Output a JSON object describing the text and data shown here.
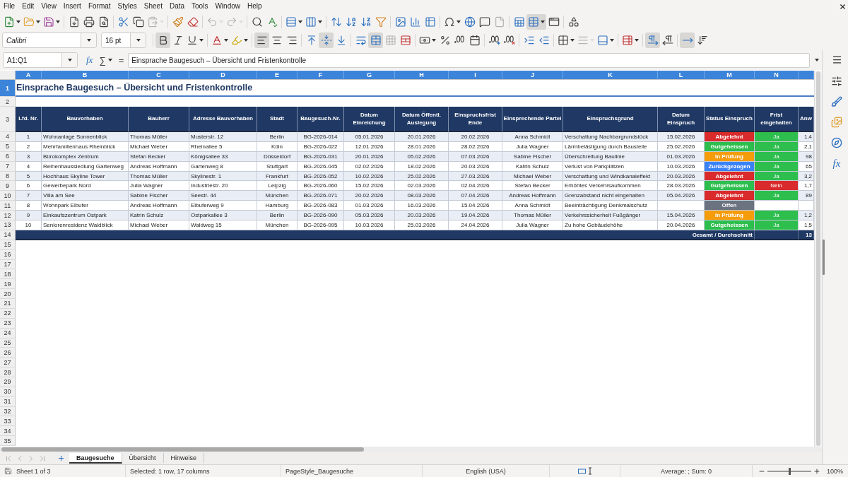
{
  "menu_bar": [
    "File",
    "Edit",
    "View",
    "Insert",
    "Format",
    "Styles",
    "Sheet",
    "Data",
    "Tools",
    "Window",
    "Help"
  ],
  "standard_toolbar": {
    "paste_enabled": false,
    "undo_enabled": false,
    "redo_enabled": false,
    "header_footer_enabled": false,
    "freeze_rows_columns": true
  },
  "formatting_toolbar": {
    "font_name": "Calibri",
    "font_size": "16 pt",
    "bold": true,
    "italic": false,
    "underline": false,
    "align_left": true,
    "align_center": false,
    "align_right": false,
    "align_top": false,
    "center_vertically": true,
    "align_bottom": false,
    "merge_and_center": true,
    "merge_cells_enabled": false,
    "border_style_enabled": false,
    "left_to_right": true,
    "right_to_left": false,
    "text_horizontal": true,
    "text_vertical": false
  },
  "formula_bar": {
    "name_box": "A1:Q1",
    "function_wizard": "fx",
    "sum": "∑",
    "formula": "=",
    "content": "Einsprache Baugesuch – Übersicht und Fristenkontrolle"
  },
  "sheet": {
    "columns": [
      {
        "label": "A",
        "selected": true
      },
      {
        "label": "B",
        "selected": true
      },
      {
        "label": "C",
        "selected": true
      },
      {
        "label": "D",
        "selected": true
      },
      {
        "label": "E",
        "selected": true
      },
      {
        "label": "F",
        "selected": true
      },
      {
        "label": "G",
        "selected": true
      },
      {
        "label": "H",
        "selected": true
      },
      {
        "label": "I",
        "selected": true
      },
      {
        "label": "J",
        "selected": true
      },
      {
        "label": "K",
        "selected": true
      },
      {
        "label": "L",
        "selected": true
      },
      {
        "label": "M",
        "selected": true
      },
      {
        "label": "N",
        "selected": true
      },
      {
        "selected": true
      }
    ],
    "rows": [
      {
        "label": "1",
        "selected": true
      },
      {
        "label": "2",
        "selected": false
      },
      {
        "label": "3",
        "selected": false
      },
      {
        "label": "4",
        "selected": false
      },
      {
        "label": "5",
        "selected": false
      },
      {
        "label": "6",
        "selected": false
      },
      {
        "label": "7",
        "selected": false
      },
      {
        "label": "8",
        "selected": false
      },
      {
        "label": "9",
        "selected": false
      },
      {
        "label": "10",
        "selected": false
      },
      {
        "label": "11",
        "selected": false
      },
      {
        "label": "12",
        "selected": false
      },
      {
        "label": "13",
        "selected": false
      },
      {
        "label": "14",
        "selected": false
      },
      {
        "label": "15",
        "selected": false
      },
      {
        "label": "16",
        "selected": false
      },
      {
        "label": "17",
        "selected": false
      },
      {
        "label": "18",
        "selected": false
      },
      {
        "label": "19",
        "selected": false
      },
      {
        "label": "20",
        "selected": false
      },
      {
        "label": "21",
        "selected": false
      },
      {
        "label": "22",
        "selected": false
      },
      {
        "label": "23",
        "selected": false
      },
      {
        "label": "24",
        "selected": false
      },
      {
        "label": "25",
        "selected": false
      },
      {
        "label": "26",
        "selected": false
      },
      {
        "label": "27",
        "selected": false
      },
      {
        "label": "28",
        "selected": false
      },
      {
        "label": "29",
        "selected": false
      },
      {
        "label": "30",
        "selected": false
      },
      {
        "label": "31",
        "selected": false
      },
      {
        "label": "32",
        "selected": false
      },
      {
        "label": "33",
        "selected": false
      },
      {
        "label": "34",
        "selected": false
      },
      {
        "label": "35",
        "selected": false
      }
    ]
  },
  "title": "Einsprache Baugesuch – Übersicht und Fristenkontrolle",
  "table": {
    "header": [
      "Lfd. Nr.",
      "Bauvorhaben",
      "Bauherr",
      "Adresse Bauvorhaben",
      "Stadt",
      "Baugesuch-Nr.",
      "Datum Einreichung",
      "Datum Öffentl. Auslegung",
      "Einspruchsfrist Ende",
      "Einsprechende Partei",
      "Einspruchsgrund",
      "Datum Einspruch",
      "Status Einspruch",
      "Frist eingehalten",
      "Anw"
    ],
    "records": [
      {
        "nr": "1",
        "project": "Wohnanlage Sonnenblick",
        "owner": "Thomas Müller",
        "address": "Musterstr. 12",
        "city": "Berlin",
        "application_no": "BG-2026-014",
        "submitted": "05.01.2026",
        "published": "20.01.2026",
        "objection_deadline": "20.02.2026",
        "objector": "Anna Schmidt",
        "reason": "Verschattung Nachbargrundstück",
        "objection_date": "15.02.2026",
        "status": {
          "text": "Abgelehnt",
          "color": "#d92b2b"
        },
        "deadline_met": {
          "text": "Ja",
          "color": "#2dbe4e"
        },
        "column_15": "1,4"
      },
      {
        "nr": "2",
        "project": "Mehrfamilienhaus Rheinblick",
        "owner": "Michael Weber",
        "address": "Rheinallee 5",
        "city": "Köln",
        "application_no": "BG-2026-022",
        "submitted": "12.01.2026",
        "published": "28.01.2026",
        "objection_deadline": "28.02.2026",
        "objector": "Julia Wagner",
        "reason": "Lärmbelästigung durch Baustelle",
        "objection_date": "25.02.2026",
        "status": {
          "text": "Gutgeheissen",
          "color": "#2dbe4e"
        },
        "deadline_met": {
          "text": "Ja",
          "color": "#2dbe4e"
        },
        "column_15": "2,1"
      },
      {
        "nr": "3",
        "project": "Bürokomplex Zentrum",
        "owner": "Stefan Becker",
        "address": "Königsallee 33",
        "city": "Düsseldorf",
        "application_no": "BG-2026-031",
        "submitted": "20.01.2026",
        "published": "05.02.2026",
        "objection_deadline": "07.03.2026",
        "objector": "Sabine Fischer",
        "reason": "Überschreitung Baulinie",
        "objection_date": "01.03.2026",
        "status": {
          "text": "In Prüfung",
          "color": "#f59c0b"
        },
        "deadline_met": {
          "text": "Ja",
          "color": "#2dbe4e"
        },
        "column_15": "98"
      },
      {
        "nr": "4",
        "project": "Reihenhaussiedlung Gartenweg",
        "owner": "Andreas Hoffmann",
        "address": "Gartenweg 8",
        "city": "Stuttgart",
        "application_no": "BG-2026-045",
        "submitted": "02.02.2026",
        "published": "18.02.2026",
        "objection_deadline": "20.03.2026",
        "objector": "Katrin Schulz",
        "reason": "Verlust von Parkplätzen",
        "objection_date": "10.03.2026",
        "status": {
          "text": "Zurückgezogen",
          "color": "#3b82f6"
        },
        "deadline_met": {
          "text": "Ja",
          "color": "#2dbe4e"
        },
        "column_15": "65"
      },
      {
        "nr": "5",
        "project": "Hochhaus Skyline Tower",
        "owner": "Thomas Müller",
        "address": "Skylinestr. 1",
        "city": "Frankfurt",
        "application_no": "BG-2026-052",
        "submitted": "10.02.2026",
        "published": "25.02.2026",
        "objection_deadline": "27.03.2026",
        "objector": "Michael Weber",
        "reason": "Verschattung und Windkanaleffekt",
        "objection_date": "20.03.2026",
        "status": {
          "text": "Abgelehnt",
          "color": "#d92b2b"
        },
        "deadline_met": {
          "text": "Ja",
          "color": "#2dbe4e"
        },
        "column_15": "3,2"
      },
      {
        "nr": "6",
        "project": "Gewerbepark Nord",
        "owner": "Julia Wagner",
        "address": "Industriestr. 20",
        "city": "Leipzig",
        "application_no": "BG-2026-060",
        "submitted": "15.02.2026",
        "published": "02.03.2026",
        "objection_deadline": "02.04.2026",
        "objector": "Stefan Becker",
        "reason": "Erhöhtes Verkehrsaufkommen",
        "objection_date": "28.03.2026",
        "status": {
          "text": "Gutgeheissen",
          "color": "#2dbe4e"
        },
        "deadline_met": {
          "text": "Nein",
          "color": "#d92b2b"
        },
        "column_15": "1,7"
      },
      {
        "nr": "7",
        "project": "Villa am See",
        "owner": "Sabine Fischer",
        "address": "Seestr. 44",
        "city": "München",
        "application_no": "BG-2026-071",
        "submitted": "20.02.2026",
        "published": "08.03.2026",
        "objection_deadline": "07.04.2026",
        "objector": "Andreas Hoffmann",
        "reason": "Grenzabstand nicht eingehalten",
        "objection_date": "05.04.2026",
        "status": {
          "text": "Abgelehnt",
          "color": "#d92b2b"
        },
        "deadline_met": {
          "text": "Ja",
          "color": "#2dbe4e"
        },
        "column_15": "89"
      },
      {
        "nr": "8",
        "project": "Wohnpark Elbufer",
        "owner": "Andreas Hoffmann",
        "address": "Elbuferweg 9",
        "city": "Hamburg",
        "application_no": "BG-2026-083",
        "submitted": "01.03.2026",
        "published": "16.03.2026",
        "objection_deadline": "15.04.2026",
        "objector": "Anna Schmidt",
        "reason": "Beeinträchtigung Denkmalschutz",
        "status": {
          "text": "Offen",
          "color": "#6b7280"
        }
      },
      {
        "nr": "9",
        "project": "Einkaufszentrum Ostpark",
        "owner": "Katrin Schulz",
        "address": "Ostparkallee 3",
        "city": "Berlin",
        "application_no": "BG-2026-090",
        "submitted": "05.03.2026",
        "published": "20.03.2026",
        "objection_deadline": "19.04.2026",
        "objector": "Thomas Müller",
        "reason": "Verkehrssicherheit Fußgänger",
        "objection_date": "15.04.2026",
        "status": {
          "text": "In Prüfung",
          "color": "#f59c0b"
        },
        "deadline_met": {
          "text": "Ja",
          "color": "#2dbe4e"
        },
        "column_15": "1,2"
      },
      {
        "nr": "10",
        "project": "Seniorenresidenz Waldblick",
        "owner": "Michael Weber",
        "address": "Waldweg 15",
        "city": "München",
        "application_no": "BG-2026-095",
        "submitted": "10.03.2026",
        "published": "25.03.2026",
        "objection_deadline": "24.04.2026",
        "objector": "Julia Wagner",
        "reason": "Zu hohe Gebäudehöhe",
        "objection_date": "20.04.2026",
        "status": {
          "text": "Gutgeheissen",
          "color": "#2dbe4e"
        },
        "deadline_met": {
          "text": "Ja",
          "color": "#2dbe4e"
        },
        "column_15": "1,5"
      }
    ],
    "total": {
      "label": "Gesamt / Durchschnitt",
      "column_15": "13"
    }
  },
  "sidebar": {
    "functions": "fx"
  },
  "sheet_tabs": [
    {
      "label": "Baugesuche",
      "selected": true
    },
    {
      "label": "Übersicht",
      "selected": false
    },
    {
      "label": "Hinweise",
      "selected": false
    }
  ],
  "status_bar": {
    "sheet": "Sheet 1 of 3",
    "selection": "Selected: 1 row, 17 columns",
    "page_style": "PageStyle_Baugesuche",
    "language": "English (USA)",
    "summary": "Average: ; Sum: 0",
    "zoom": {
      "level": 0.5,
      "reading": "100%"
    }
  }
}
